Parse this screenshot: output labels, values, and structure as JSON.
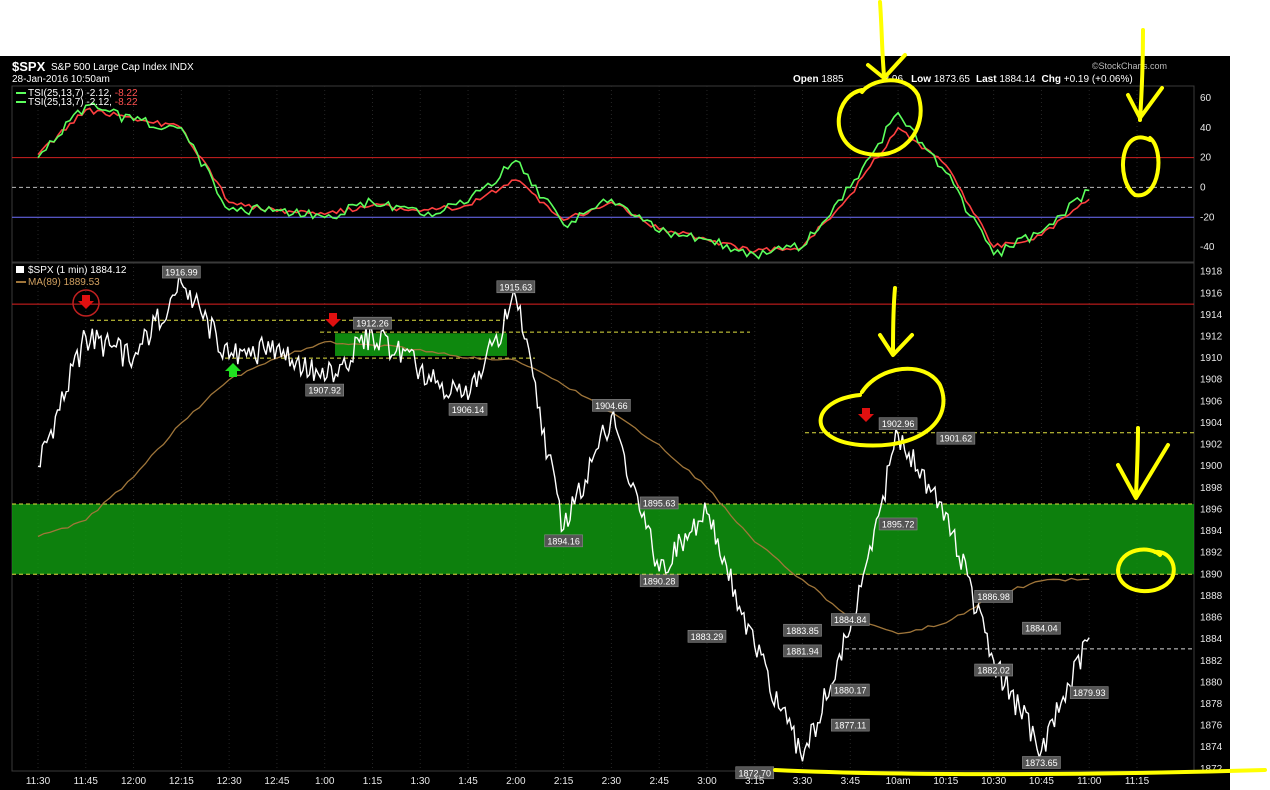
{
  "header": {
    "symbol": "$SPX",
    "name": "S&P 500 Large Cap Index",
    "exchange": "INDX",
    "datetime": "28-Jan-2016 10:50am",
    "open_label": "Open",
    "open_value": "1885",
    "high_value": "3.96",
    "low_label": "Low",
    "low_value": "1873.65",
    "last_label": "Last",
    "last_value": "1884.14",
    "chg_label": "Chg",
    "chg_value": "+0.19 (+0.06%)",
    "watermark": "©StockCharts.com"
  },
  "legend": {
    "tsi_line1_main": "TSI(25,13,7)",
    "tsi_line1_val1": "-2.12,",
    "tsi_line1_val2": "-8.22",
    "tsi_line2_main": "TSI(25,13,7)",
    "tsi_line2_val1": "-2.12,",
    "tsi_line2_val2": "-8.22",
    "price_main": "$SPX (1 min)",
    "price_val": "1884.12",
    "ma_main": "MA(89)",
    "ma_val": "1889.53"
  },
  "colors": {
    "background": "#000000",
    "price_line": "#ffffff",
    "price_line_highlight": "#b8f3a0",
    "tsi_line": "#5cff5c",
    "tsi_signal": "#ff4040",
    "ma_line": "#a0763a",
    "resistance_line": "#e02020",
    "support_zone": "#10a010",
    "dashed_level": "#e0e040",
    "annotation": "#ffff00",
    "arrow_down": "#e01010",
    "arrow_up": "#20e020"
  },
  "chart_data": [
    {
      "type": "line",
      "name": "TSI",
      "x_ticks": [
        "11:30",
        "11:45",
        "12:00",
        "12:15",
        "12:30",
        "12:45",
        "1:00",
        "1:15",
        "1:30",
        "1:45",
        "2:00",
        "2:15",
        "2:30",
        "2:45",
        "3:00",
        "3:15",
        "3:30",
        "3:45",
        "10am",
        "10:15",
        "10:30",
        "10:45",
        "11:00",
        "11:15"
      ],
      "y_ticks": [
        60,
        40,
        20,
        0,
        -20,
        -40
      ],
      "ylim": [
        -50,
        68
      ],
      "reference_lines": [
        20,
        0,
        -20
      ],
      "series": [
        {
          "name": "TSI(25,13,7)",
          "x": [
            "11:30",
            "11:45",
            "12:00",
            "12:15",
            "12:30",
            "12:45",
            "1:00",
            "1:15",
            "1:30",
            "1:45",
            "2:00",
            "2:15",
            "2:30",
            "2:45",
            "3:00",
            "3:15",
            "3:30",
            "3:45",
            "10am",
            "10:15",
            "10:30",
            "10:45",
            "11:00"
          ],
          "values": [
            20,
            55,
            45,
            40,
            -15,
            -15,
            -20,
            -10,
            -18,
            -10,
            18,
            -25,
            -8,
            -30,
            -35,
            -45,
            -40,
            0,
            50,
            10,
            -45,
            -30,
            -2
          ]
        },
        {
          "name": "Signal",
          "x": [
            "11:30",
            "11:45",
            "12:00",
            "12:15",
            "12:30",
            "12:45",
            "1:00",
            "1:15",
            "1:30",
            "1:45",
            "2:00",
            "2:15",
            "2:30",
            "2:45",
            "3:00",
            "3:15",
            "3:30",
            "3:45",
            "10am",
            "10:15",
            "10:30",
            "10:45",
            "11:00"
          ],
          "values": [
            22,
            52,
            46,
            40,
            -10,
            -16,
            -18,
            -12,
            -16,
            -12,
            5,
            -22,
            -10,
            -28,
            -35,
            -43,
            -40,
            -5,
            40,
            15,
            -40,
            -32,
            -8
          ]
        }
      ]
    },
    {
      "type": "line",
      "name": "$SPX (1 min)",
      "x_ticks": [
        "11:30",
        "11:45",
        "12:00",
        "12:15",
        "12:30",
        "12:45",
        "1:00",
        "1:15",
        "1:30",
        "1:45",
        "2:00",
        "2:15",
        "2:30",
        "2:45",
        "3:00",
        "3:15",
        "3:30",
        "3:45",
        "10am",
        "10:15",
        "10:30",
        "10:45",
        "11:00",
        "11:15"
      ],
      "y_ticks": [
        1918,
        1916,
        1914,
        1912,
        1910,
        1908,
        1906,
        1904,
        1902,
        1900,
        1898,
        1896,
        1894,
        1892,
        1890,
        1888,
        1886,
        1884,
        1882,
        1880,
        1878,
        1876,
        1874,
        1872
      ],
      "ylim": [
        1871.8,
        1918.8
      ],
      "series": [
        {
          "name": "$SPX",
          "x": [
            "11:30",
            "11:45",
            "12:00",
            "12:15",
            "12:30",
            "12:45",
            "1:00",
            "1:15",
            "1:30",
            "1:45",
            "2:00",
            "2:15",
            "2:30",
            "2:45",
            "3:00",
            "3:15",
            "3:30",
            "3:45",
            "10am",
            "10:15",
            "10:30",
            "10:45",
            "11:00"
          ],
          "values": [
            1900,
            1912,
            1910,
            1916.99,
            1910,
            1911,
            1907.92,
            1912.26,
            1909,
            1906.14,
            1915.63,
            1894.16,
            1904.66,
            1890.28,
            1895.63,
            1883.29,
            1872.7,
            1884.84,
            1902.96,
            1895.72,
            1882.02,
            1873.65,
            1884.14
          ]
        },
        {
          "name": "MA(89)",
          "x": [
            "11:30",
            "11:45",
            "12:00",
            "12:15",
            "12:30",
            "12:45",
            "1:00",
            "1:15",
            "1:30",
            "1:45",
            "2:00",
            "2:15",
            "2:30",
            "2:45",
            "3:00",
            "3:15",
            "3:30",
            "3:45",
            "10am",
            "10:15",
            "10:30",
            "10:45",
            "11:00"
          ],
          "values": [
            1893.5,
            1895,
            1899,
            1904,
            1908,
            1910,
            1911.5,
            1911.2,
            1910.8,
            1910,
            1909.8,
            1907.5,
            1905,
            1902,
            1898,
            1893,
            1889.5,
            1886,
            1884.5,
            1885.5,
            1888,
            1889.4,
            1889.53
          ]
        }
      ],
      "reference_lines": [
        {
          "value": 1915,
          "style": "solid"
        },
        {
          "value": 1913.5,
          "style": "dashed"
        },
        {
          "value": 1912.4,
          "style": "dashed"
        },
        {
          "value": 1910,
          "style": "dashed"
        },
        {
          "value": 1903.1,
          "style": "dashed"
        },
        {
          "value": 1896.5,
          "style": "dashed"
        },
        {
          "value": 1890,
          "style": "dashed"
        },
        {
          "value": 1883.1,
          "style": "dashed"
        }
      ],
      "zones": [
        {
          "from": 1890,
          "to": 1896.5
        },
        {
          "from": 1910.2,
          "to": 1912.3
        }
      ],
      "labels": [
        {
          "x": "12:15",
          "value": 1916.99,
          "text": "1916.99"
        },
        {
          "x": "1:00",
          "value": 1907.92,
          "text": "1907.92"
        },
        {
          "x": "1:15",
          "value": 1912.26,
          "text": "1912.26"
        },
        {
          "x": "1:45",
          "value": 1906.14,
          "text": "1906.14"
        },
        {
          "x": "2:00",
          "value": 1915.63,
          "text": "1915.63"
        },
        {
          "x": "2:15",
          "value": 1894.16,
          "text": "1894.16"
        },
        {
          "x": "2:30",
          "value": 1904.66,
          "text": "1904.66"
        },
        {
          "x": "2:45",
          "value": 1895.63,
          "text": "1895.63"
        },
        {
          "x": "2:45",
          "value": 1890.28,
          "text": "1890.28"
        },
        {
          "x": "3:00",
          "value": 1883.29,
          "text": "1883.29"
        },
        {
          "x": "3:30",
          "value": 1881.94,
          "text": "1881.94"
        },
        {
          "x": "3:30",
          "value": 1883.85,
          "text": "1883.85"
        },
        {
          "x": "3:45",
          "value": 1884.84,
          "text": "1884.84"
        },
        {
          "x": "3:45",
          "value": 1877.11,
          "text": "1877.11"
        },
        {
          "x": "3:45",
          "value": 1880.17,
          "text": "1880.17"
        },
        {
          "x": "3:15",
          "value": 1872.7,
          "text": "1872.70"
        },
        {
          "x": "10am",
          "value": 1902.96,
          "text": "1902.96"
        },
        {
          "x": "10am",
          "value": 1895.72,
          "text": "1895.72"
        },
        {
          "x": "10:15",
          "value": 1901.62,
          "text": "1901.62"
        },
        {
          "x": "10:30",
          "value": 1886.98,
          "text": "1886.98"
        },
        {
          "x": "10:30",
          "value": 1882.02,
          "text": "1882.02"
        },
        {
          "x": "10:45",
          "value": 1873.65,
          "text": "1873.65"
        },
        {
          "x": "10:45",
          "value": 1884.04,
          "text": "1884.04"
        },
        {
          "x": "11:00",
          "value": 1879.93,
          "text": "1879.93"
        }
      ]
    }
  ]
}
